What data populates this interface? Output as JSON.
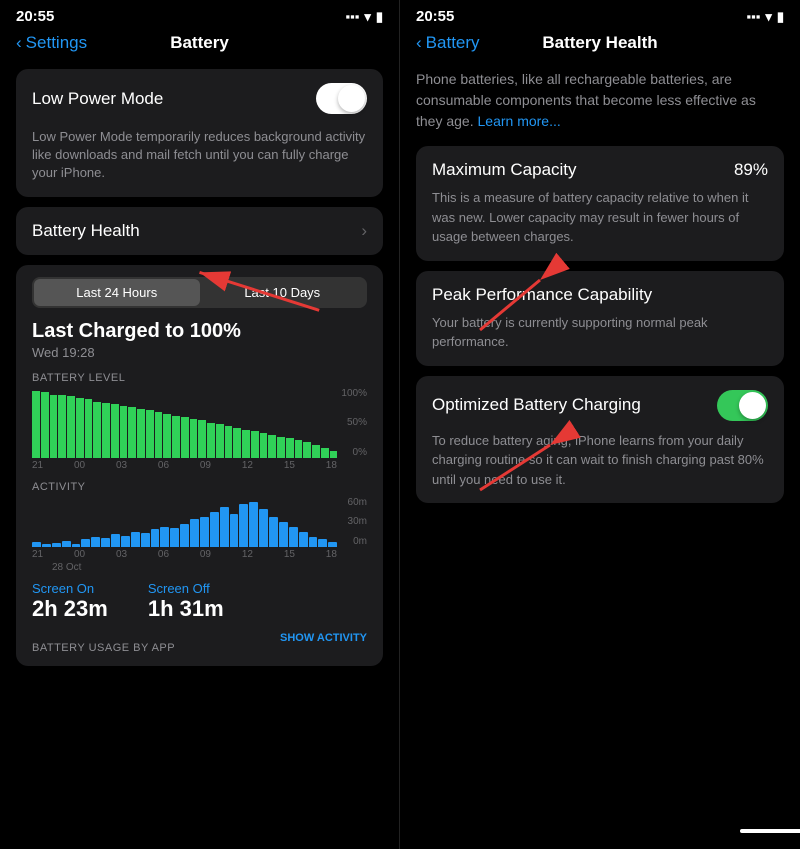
{
  "left_screen": {
    "status_time": "20:55",
    "nav_back": "Settings",
    "nav_title": "Battery",
    "low_power_mode_label": "Low Power Mode",
    "low_power_mode_desc": "Low Power Mode temporarily reduces background activity like downloads and mail fetch until you can fully charge your iPhone.",
    "battery_health_label": "Battery Health",
    "tabs": [
      "Last 24 Hours",
      "Last 10 Days"
    ],
    "active_tab": 0,
    "charged_label": "Last Charged to 100%",
    "charged_time": "Wed 19:28",
    "battery_level_label": "BATTERY LEVEL",
    "chart_right_labels": [
      "100%",
      "50%",
      "0%"
    ],
    "chart_time_labels": [
      "21",
      "00",
      "03",
      "06",
      "09",
      "12",
      "15",
      "18"
    ],
    "activity_label": "ACTIVITY",
    "activity_right_labels": [
      "60m",
      "30m",
      "0m"
    ],
    "activity_time_labels": [
      "21",
      "00",
      "03",
      "06",
      "09",
      "12",
      "15",
      "18"
    ],
    "date_label": "28 Oct",
    "screen_on_label": "Screen On",
    "screen_on_time": "2h 23m",
    "screen_off_label": "Screen Off",
    "screen_off_time": "1h 31m",
    "bottom_label": "BATTERY USAGE BY APP",
    "show_activity": "SHOW ACTIVITY"
  },
  "right_screen": {
    "status_time": "20:55",
    "nav_back": "Battery",
    "nav_title": "Battery Health",
    "intro_text": "Phone batteries, like all rechargeable batteries, are consumable components that become less effective as they age.",
    "learn_more": "Learn more...",
    "max_capacity_label": "Maximum Capacity",
    "max_capacity_value": "89%",
    "max_capacity_desc": "This is a measure of battery capacity relative to when it was new. Lower capacity may result in fewer hours of usage between charges.",
    "peak_performance_label": "Peak Performance Capability",
    "peak_performance_desc": "Your battery is currently supporting normal peak performance.",
    "optimized_label": "Optimized Battery Charging",
    "optimized_desc": "To reduce battery aging, iPhone learns from your daily charging routine so it can wait to finish charging past 80% until you need to use it."
  }
}
